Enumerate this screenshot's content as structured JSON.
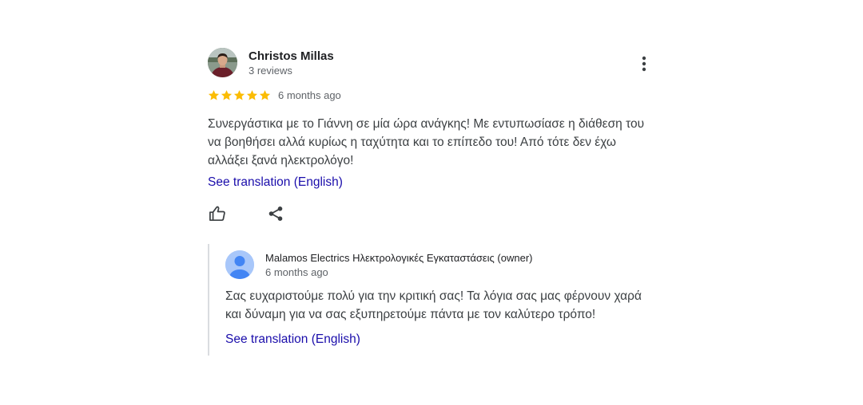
{
  "review": {
    "reviewer_name": "Christos Millas",
    "reviewer_meta": "3 reviews",
    "rating": 5,
    "max_rating": 5,
    "date": "6 months ago",
    "text": "Συνεργάστικα με το Γιάννη σε μία ώρα ανάγκης! Με εντυπωσίασε η διάθεση του να βοηθήσει αλλά κυρίως η ταχύτητα και το επίπεδο του! Από τότε δεν έχω αλλάξει ξανά ηλεκτρολόγο!",
    "translate_label": "See translation (English)",
    "star_color": "#fbbc04",
    "icons": {
      "more": "more-vert-icon",
      "like": "thumb-up-icon",
      "share": "share-icon"
    }
  },
  "owner_response": {
    "name": "Malamos Electrics Ηλεκτρολογικές Εγκαταστάσεις (owner)",
    "date": "6 months ago",
    "text": "Σας ευχαριστούμε πολύ για την κριτική σας! Τα λόγια σας μας φέρνουν χαρά και δύναμη για να σας εξυπηρετούμε πάντα με τον καλύτερο τρόπο!",
    "translate_label": "See translation (English)"
  },
  "colors": {
    "link": "#1a0dab",
    "muted": "#5f6368",
    "reply_border": "#dadce0"
  }
}
